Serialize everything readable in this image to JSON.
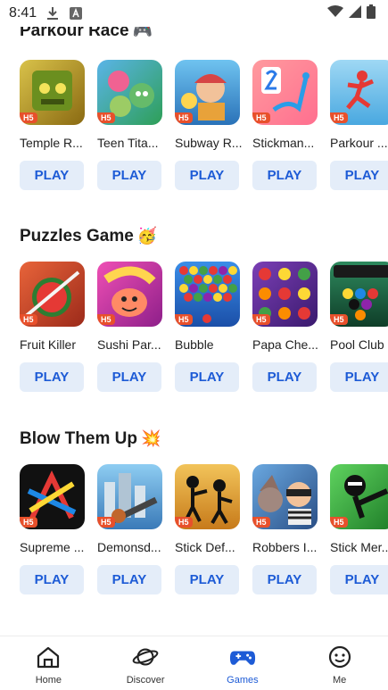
{
  "status": {
    "time": "8:41"
  },
  "sections": [
    {
      "title": "Parkour Race",
      "emoji": "🎮",
      "games": [
        {
          "name": "Temple R...",
          "play": "PLAY",
          "badge": "H5",
          "color": "#b89a2a"
        },
        {
          "name": "Teen Tita...",
          "play": "PLAY",
          "badge": "H5",
          "color": "#2e9f57"
        },
        {
          "name": "Subway R...",
          "play": "PLAY",
          "badge": "H5",
          "color": "#3b8fd6"
        },
        {
          "name": "Stickman...",
          "play": "PLAY",
          "badge": "H5",
          "color": "#ff6f8f"
        },
        {
          "name": "Parkour ...",
          "play": "PLAY",
          "badge": "H5",
          "color": "#49a8e0"
        }
      ]
    },
    {
      "title": "Puzzles Game",
      "emoji": "🥳",
      "games": [
        {
          "name": "Fruit Killer",
          "play": "PLAY",
          "badge": "H5",
          "color": "#c0392b"
        },
        {
          "name": "Sushi Par...",
          "play": "PLAY",
          "badge": "H5",
          "color": "#d63fa8"
        },
        {
          "name": "Bubble",
          "play": "PLAY",
          "badge": "H5",
          "color": "#2e7fd6"
        },
        {
          "name": "Papa Che...",
          "play": "PLAY",
          "badge": "H5",
          "color": "#7b3fb5"
        },
        {
          "name": "Pool Club",
          "play": "PLAY",
          "badge": "H5",
          "color": "#1f6e4a"
        }
      ]
    },
    {
      "title": "Blow Them Up",
      "emoji": "💥",
      "games": [
        {
          "name": "Supreme ...",
          "play": "PLAY",
          "badge": "H5",
          "color": "#111111"
        },
        {
          "name": "Demonsd...",
          "play": "PLAY",
          "badge": "H5",
          "color": "#5aa0d6"
        },
        {
          "name": "Stick Def...",
          "play": "PLAY",
          "badge": "H5",
          "color": "#e0a23a"
        },
        {
          "name": "Robbers I...",
          "play": "PLAY",
          "badge": "H5",
          "color": "#3a6ea8"
        },
        {
          "name": "Stick Mer...",
          "play": "PLAY",
          "badge": "H5",
          "color": "#2f9e3a"
        }
      ]
    }
  ],
  "nav": [
    {
      "label": "Home",
      "icon": "home-icon"
    },
    {
      "label": "Discover",
      "icon": "planet-icon"
    },
    {
      "label": "Games",
      "icon": "gamepad-icon"
    },
    {
      "label": "Me",
      "icon": "smile-icon"
    }
  ]
}
